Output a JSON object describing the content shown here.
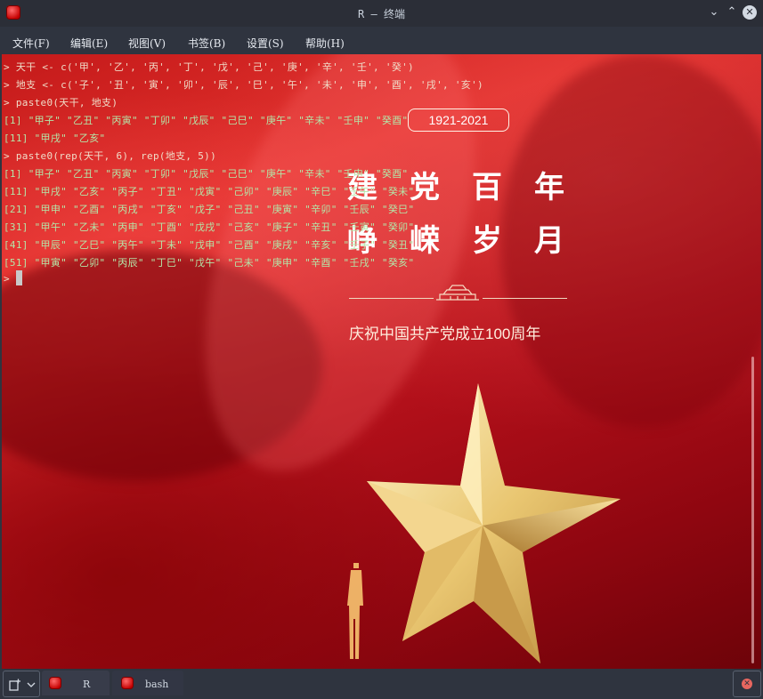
{
  "window": {
    "title": "R — 终端",
    "minimize_glyph": "⌄",
    "maximize_glyph": "⌃",
    "close_glyph": "✕"
  },
  "menu": [
    {
      "label": "文件(F)"
    },
    {
      "label": "编辑(E)"
    },
    {
      "label": "视图(V)"
    },
    {
      "label": "书签(B)"
    },
    {
      "label": "设置(S)"
    },
    {
      "label": "帮助(H)"
    }
  ],
  "terminal": {
    "lines": [
      "> 天干 <- c('甲', '乙', '丙', '丁', '戊', '己', '庚', '辛', '壬', '癸')",
      "> 地支 <- c('子', '丑', '寅', '卯', '辰', '巳', '午', '未', '申', '酉', '戌', '亥')",
      "> paste0(天干, 地支)",
      "[1] \"甲子\" \"乙丑\" \"丙寅\" \"丁卯\" \"戊辰\" \"己巳\" \"庚午\" \"辛未\" \"壬申\" \"癸酉\"",
      "[11] \"甲戌\" \"乙亥\"",
      "> paste0(rep(天干, 6), rep(地支, 5))",
      "[1] \"甲子\" \"乙丑\" \"丙寅\" \"丁卯\" \"戊辰\" \"己巳\" \"庚午\" \"辛未\" \"壬申\" \"癸酉\"",
      "[11] \"甲戌\" \"乙亥\" \"丙子\" \"丁丑\" \"戊寅\" \"己卯\" \"庚辰\" \"辛巳\" \"壬午\" \"癸未\"",
      "[21] \"甲申\" \"乙酉\" \"丙戌\" \"丁亥\" \"戊子\" \"己丑\" \"庚寅\" \"辛卯\" \"壬辰\" \"癸巳\"",
      "[31] \"甲午\" \"乙未\" \"丙申\" \"丁酉\" \"戊戌\" \"己亥\" \"庚子\" \"辛丑\" \"壬寅\" \"癸卯\"",
      "[41] \"甲辰\" \"乙巳\" \"丙午\" \"丁未\" \"戊申\" \"己酉\" \"庚戌\" \"辛亥\" \"壬子\" \"癸丑\"",
      "[51] \"甲寅\" \"乙卯\" \"丙辰\" \"丁巳\" \"戊午\" \"己未\" \"庚申\" \"辛酉\" \"壬戌\" \"癸亥\"",
      ">"
    ]
  },
  "wallpaper": {
    "year_badge": "1921-2021",
    "headline_1": "建党百年",
    "headline_2": "峥嵘岁月",
    "subtitle": "庆祝中国共产党成立100周年",
    "accent_gold": "#f3d27a",
    "background_red": "#c41a1a"
  },
  "tabs": [
    {
      "label": "R"
    },
    {
      "label": "bash"
    }
  ]
}
